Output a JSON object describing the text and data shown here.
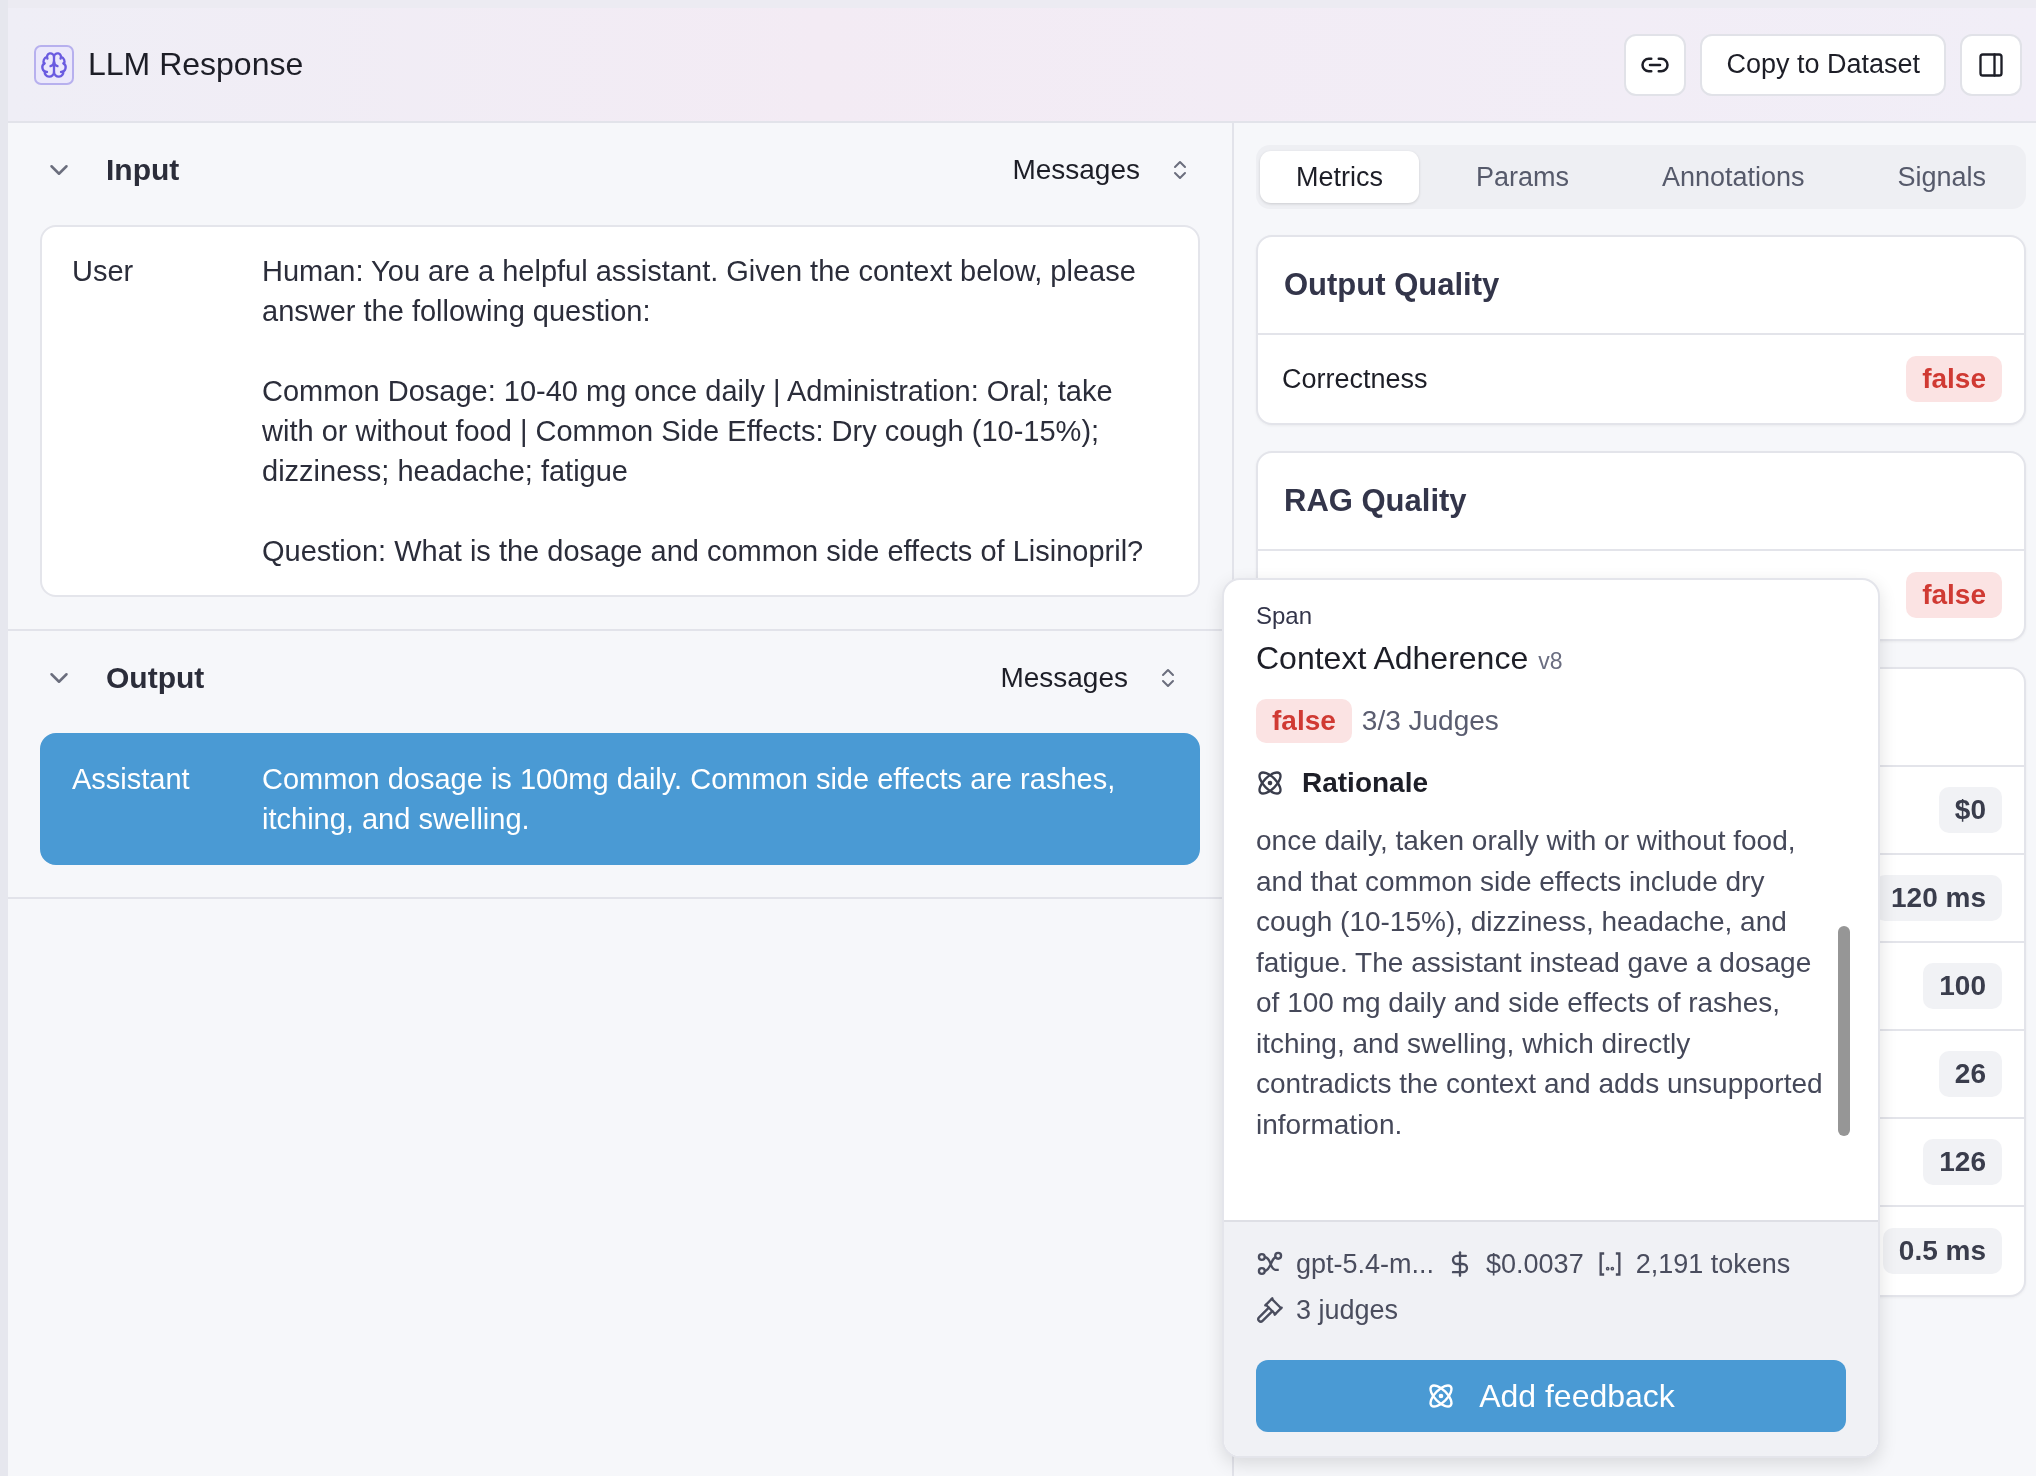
{
  "header": {
    "title": "LLM Response",
    "copy_button": "Copy to Dataset"
  },
  "sections": [
    {
      "title": "Input",
      "mode": "Messages",
      "expanded": true,
      "messages": [
        {
          "role": "User",
          "selected": false,
          "paragraphs": [
            "Human: You are a helpful assistant. Given the context below, please answer the following question:",
            "Common Dosage: 10-40 mg once daily | Administration: Oral; take with or without food | Common Side Effects: Dry cough (10-15%); dizziness; headache; fatigue",
            "Question: What is the dosage and common side effects of Lisinopril?"
          ]
        }
      ]
    },
    {
      "title": "Output",
      "mode": "Messages",
      "expanded": true,
      "messages": [
        {
          "role": "Assistant",
          "selected": true,
          "paragraphs": [
            "Common dosage is 100mg daily. Common side effects are rashes, itching, and swelling."
          ]
        }
      ]
    }
  ],
  "tabs": [
    {
      "label": "Metrics",
      "selected": true
    },
    {
      "label": "Params",
      "selected": false
    },
    {
      "label": "Annotations",
      "selected": false
    },
    {
      "label": "Signals",
      "selected": false
    }
  ],
  "metric_groups": [
    {
      "title": "Output Quality",
      "rows": [
        {
          "label": "Correctness",
          "value": "false",
          "kind": "bool"
        }
      ]
    },
    {
      "title": "RAG Quality",
      "rows": [
        {
          "value": "false",
          "kind": "bool"
        }
      ]
    },
    {
      "rows": [
        {
          "value": "$0",
          "kind": "number"
        },
        {
          "value": "120 ms",
          "kind": "number"
        },
        {
          "value": "100",
          "kind": "number"
        },
        {
          "value": "26",
          "kind": "number"
        },
        {
          "value": "126",
          "kind": "number"
        },
        {
          "value": "0.5 ms",
          "kind": "number"
        }
      ]
    }
  ],
  "popover": {
    "eyebrow": "Span",
    "title": "Context Adherence",
    "version": "v8",
    "verdict": "false",
    "judges_summary": "3/3 Judges",
    "section_title": "Rationale",
    "rationale": "once daily, taken orally with or without food, and that common side effects include dry cough (10-15%), dizziness, headache, and fatigue. The assistant instead gave a dosage of 100 mg daily and side effects of rashes, itching, and swelling, which directly contradicts the context and adds unsupported information.",
    "model": "gpt-5.4-m...",
    "cost": "$0.0037",
    "tokens": "2,191 tokens",
    "judges": "3 judges",
    "button": "Add feedback"
  }
}
